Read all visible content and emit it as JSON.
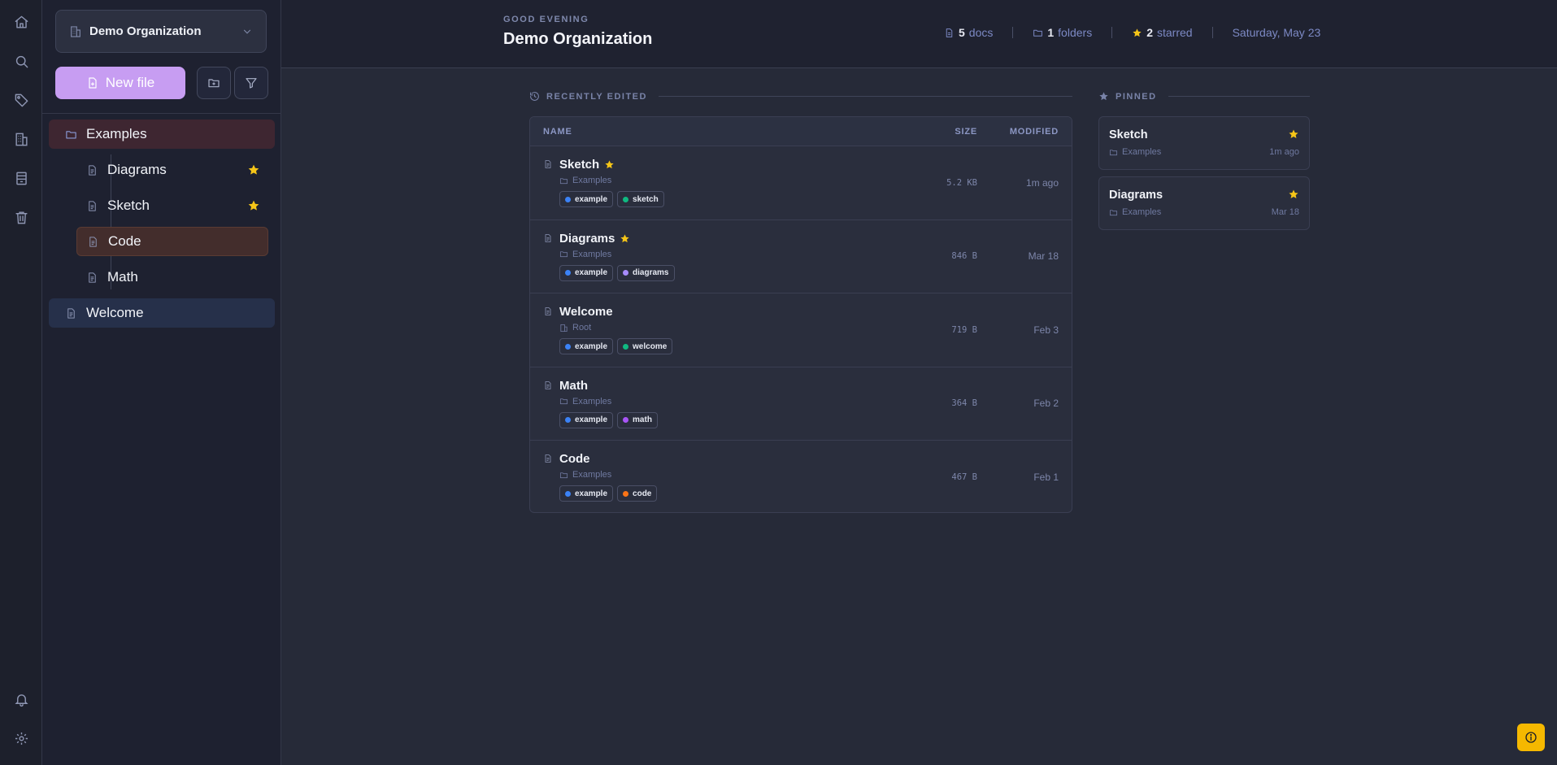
{
  "colors": {
    "accent": "#c79df2",
    "star": "#f5c518",
    "help": "#f5b800"
  },
  "rail": {
    "top": [
      "home-icon",
      "search-icon",
      "tag-icon",
      "building-icon",
      "archive-icon",
      "trash-icon"
    ],
    "bottom": [
      "bell-icon",
      "gear-icon"
    ]
  },
  "sidebar": {
    "org_name": "Demo Organization",
    "new_file_label": "New file",
    "tree": [
      {
        "label": "Examples",
        "type": "folder",
        "starred": false
      },
      {
        "label": "Diagrams",
        "type": "file",
        "starred": true
      },
      {
        "label": "Sketch",
        "type": "file",
        "starred": true
      },
      {
        "label": "Code",
        "type": "file",
        "starred": false
      },
      {
        "label": "Math",
        "type": "file",
        "starred": false
      },
      {
        "label": "Welcome",
        "type": "file",
        "starred": false
      }
    ]
  },
  "header": {
    "greeting": "GOOD EVENING",
    "title": "Demo Organization",
    "docs_count": "5",
    "docs_label": "docs",
    "folders_count": "1",
    "folders_label": "folders",
    "starred_count": "2",
    "starred_label": "starred",
    "date": "Saturday, May 23"
  },
  "recent": {
    "heading": "RECENTLY EDITED",
    "columns": {
      "name": "NAME",
      "size": "SIZE",
      "modified": "MODIFIED"
    },
    "rows": [
      {
        "title": "Sketch",
        "starred": true,
        "folder": "Examples",
        "tags": [
          {
            "name": "example",
            "color": "#3b82f6"
          },
          {
            "name": "sketch",
            "color": "#10b981"
          }
        ],
        "size": "5.2 KB",
        "modified": "1m ago"
      },
      {
        "title": "Diagrams",
        "starred": true,
        "folder": "Examples",
        "tags": [
          {
            "name": "example",
            "color": "#3b82f6"
          },
          {
            "name": "diagrams",
            "color": "#a78bfa"
          }
        ],
        "size": "846 B",
        "modified": "Mar 18"
      },
      {
        "title": "Welcome",
        "starred": false,
        "folder": "Root",
        "tags": [
          {
            "name": "example",
            "color": "#3b82f6"
          },
          {
            "name": "welcome",
            "color": "#10b981"
          }
        ],
        "size": "719 B",
        "modified": "Feb 3"
      },
      {
        "title": "Math",
        "starred": false,
        "folder": "Examples",
        "tags": [
          {
            "name": "example",
            "color": "#3b82f6"
          },
          {
            "name": "math",
            "color": "#a855f7"
          }
        ],
        "size": "364 B",
        "modified": "Feb 2"
      },
      {
        "title": "Code",
        "starred": false,
        "folder": "Examples",
        "tags": [
          {
            "name": "example",
            "color": "#3b82f6"
          },
          {
            "name": "code",
            "color": "#f97316"
          }
        ],
        "size": "467 B",
        "modified": "Feb 1"
      }
    ]
  },
  "pinned": {
    "heading": "PINNED",
    "items": [
      {
        "title": "Sketch",
        "folder": "Examples",
        "modified": "1m ago"
      },
      {
        "title": "Diagrams",
        "folder": "Examples",
        "modified": "Mar 18"
      }
    ]
  }
}
